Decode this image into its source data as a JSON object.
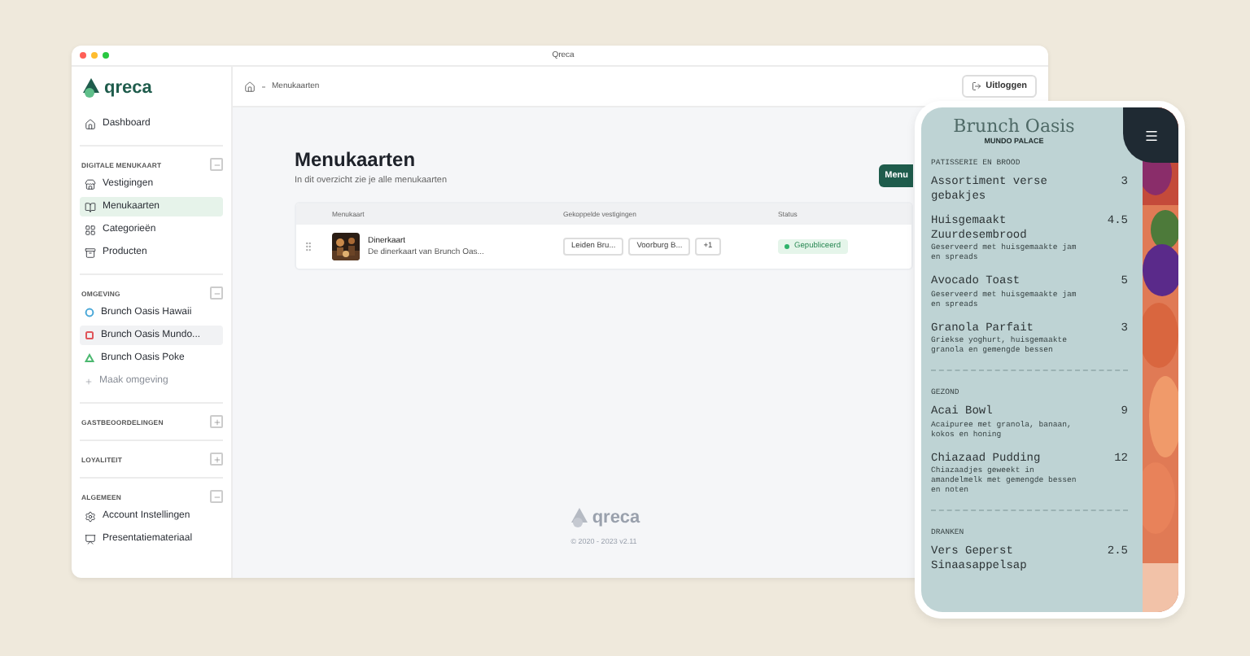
{
  "window": {
    "title": "Qreca"
  },
  "sidebar": {
    "logo": "qreca",
    "dashboard": {
      "label": "Dashboard",
      "selected": false
    },
    "sections": [
      {
        "title": "DIGITALE MENUKAART",
        "expanded": true,
        "items": [
          {
            "label": "Vestigingen",
            "selected": false
          },
          {
            "label": "Menukaarten",
            "selected": true
          },
          {
            "label": "Categorieën",
            "selected": false
          },
          {
            "label": "Producten",
            "selected": false
          }
        ]
      },
      {
        "title": "OMGEVING",
        "expanded": true,
        "items": [
          {
            "kind": "environment",
            "label": "Brunch Oasis Hawaii",
            "selected": false,
            "color": "#4aa8d8"
          },
          {
            "kind": "environment",
            "label": "Brunch Oasis Mundo...",
            "selected": true,
            "color": "#e0555a"
          },
          {
            "kind": "environment",
            "label": "Brunch Oasis Poke",
            "selected": false,
            "color": "#4cb870"
          },
          {
            "kind": "action",
            "label": "Maak omgeving",
            "selected": false
          }
        ]
      },
      {
        "title": "GASTBEOORDELINGEN",
        "expanded": false
      },
      {
        "title": "LOYALITEIT",
        "expanded": false
      },
      {
        "title": "ALGEMEEN",
        "expanded": true,
        "items": [
          {
            "label": "Account Instellingen",
            "selected": false
          },
          {
            "label": "Presentatiemateriaal",
            "selected": false
          }
        ]
      }
    ]
  },
  "topbar": {
    "breadcrumb": "Menukaarten",
    "logout": "Uitloggen"
  },
  "page": {
    "title": "Menukaarten",
    "subtitle": "In dit overzicht zie je alle menukaarten",
    "button": "Menu"
  },
  "table": {
    "columns": [
      "Menukaart",
      "Gekoppelde vestigingen",
      "Status"
    ],
    "rows": [
      {
        "name": "Dinerkaart",
        "description": "De dinerkaart van Brunch Oas...",
        "locations": [
          "Leiden Bru...",
          "Voorburg B...",
          "+1"
        ],
        "status": "Gepubliceerd",
        "published": true
      }
    ]
  },
  "footer": {
    "logo": "qreca",
    "copyright": "© 2020 - 2023 v2.11"
  },
  "phone": {
    "title": "Brunch Oasis",
    "subtitle": "MUNDO PALACE",
    "sections": [
      {
        "title": "PATISSERIE EN BROOD",
        "items": [
          {
            "name": "Assortiment verse gebakjes",
            "price": "3"
          },
          {
            "name": "Huisgemaakt Zuurdesembrood",
            "price": "4.5",
            "description": "Geserveerd met huisgemaakte jam en spreads"
          },
          {
            "name": "Avocado Toast",
            "price": "5",
            "description": "Geserveerd met huisgemaakte jam en spreads"
          },
          {
            "name": "Granola Parfait",
            "price": "3",
            "description": "Griekse yoghurt, huisgemaakte granola en gemengde bessen"
          }
        ]
      },
      {
        "title": "GEZOND",
        "items": [
          {
            "name": "Acai Bowl",
            "price": "9",
            "description": "Acaipuree met granola, banaan, kokos en honing"
          },
          {
            "name": "Chiazaad Pudding",
            "price": "12",
            "description": "Chiazaadjes geweekt in amandelmelk met gemengde bessen en noten"
          }
        ]
      },
      {
        "title": "DRANKEN",
        "items": [
          {
            "name": "Vers Geperst Sinaasappelsap",
            "price": "2.5"
          }
        ]
      }
    ]
  }
}
